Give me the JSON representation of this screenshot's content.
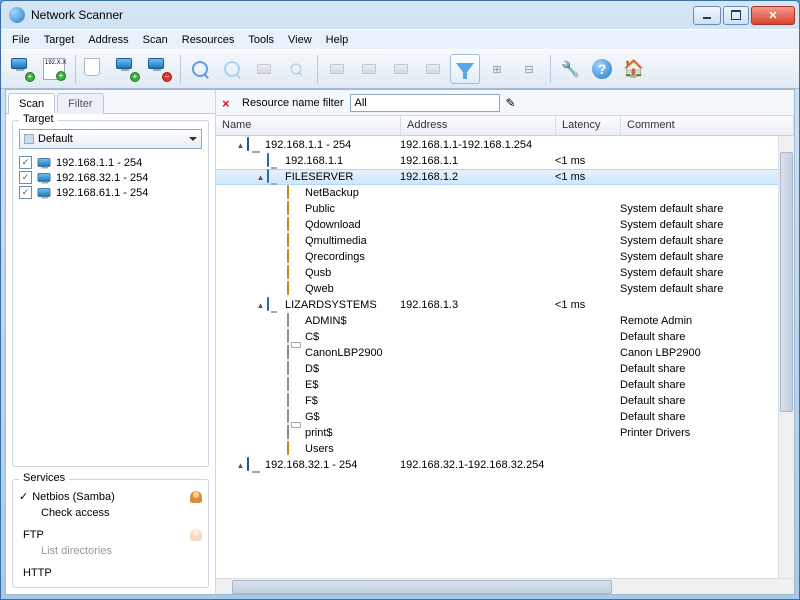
{
  "window": {
    "title": "Network Scanner"
  },
  "menu": [
    "File",
    "Target",
    "Address",
    "Scan",
    "Resources",
    "Tools",
    "View",
    "Help"
  ],
  "sidebar": {
    "tabs": [
      "Scan",
      "Filter"
    ],
    "active_tab": 0,
    "target_group": "Target",
    "default_combo": "Default",
    "ranges": [
      {
        "checked": true,
        "label": "192.168.1.1 - 254"
      },
      {
        "checked": true,
        "label": "192.168.32.1 - 254"
      },
      {
        "checked": true,
        "label": "192.168.61.1 - 254"
      }
    ],
    "services_group": "Services",
    "services": [
      {
        "checked": true,
        "label": "Netbios (Samba)",
        "sub": "Check access",
        "sub_checked": false
      },
      {
        "checked": false,
        "label": "FTP",
        "sub": "List directories",
        "sub_checked": false
      },
      {
        "checked": false,
        "label": "HTTP",
        "sub": null
      }
    ]
  },
  "filter": {
    "close": "×",
    "label": "Resource name filter",
    "value": "All"
  },
  "columns": {
    "name": "Name",
    "address": "Address",
    "latency": "Latency",
    "comment": "Comment"
  },
  "tree": [
    {
      "depth": 0,
      "exp": "▲",
      "icon": "monitors",
      "name": "192.168.1.1 - 254",
      "addr": "192.168.1.1-192.168.1.254",
      "lat": "",
      "com": ""
    },
    {
      "depth": 1,
      "exp": "",
      "icon": "monitor",
      "name": "192.168.1.1",
      "addr": "192.168.1.1",
      "lat": "<1 ms",
      "com": ""
    },
    {
      "depth": 1,
      "exp": "▲",
      "icon": "monitor",
      "name": "FILESERVER",
      "addr": "192.168.1.2",
      "lat": "<1 ms",
      "com": "",
      "sel": true
    },
    {
      "depth": 2,
      "exp": "",
      "icon": "folder",
      "name": "NetBackup",
      "addr": "",
      "lat": "",
      "com": ""
    },
    {
      "depth": 2,
      "exp": "",
      "icon": "folder",
      "name": "Public",
      "addr": "",
      "lat": "",
      "com": "System default share"
    },
    {
      "depth": 2,
      "exp": "",
      "icon": "folder",
      "name": "Qdownload",
      "addr": "",
      "lat": "",
      "com": "System default share"
    },
    {
      "depth": 2,
      "exp": "",
      "icon": "folder",
      "name": "Qmultimedia",
      "addr": "",
      "lat": "",
      "com": "System default share"
    },
    {
      "depth": 2,
      "exp": "",
      "icon": "folder",
      "name": "Qrecordings",
      "addr": "",
      "lat": "",
      "com": "System default share"
    },
    {
      "depth": 2,
      "exp": "",
      "icon": "folder",
      "name": "Qusb",
      "addr": "",
      "lat": "",
      "com": "System default share"
    },
    {
      "depth": 2,
      "exp": "",
      "icon": "folder",
      "name": "Qweb",
      "addr": "",
      "lat": "",
      "com": "System default share"
    },
    {
      "depth": 1,
      "exp": "▲",
      "icon": "monitor",
      "name": "LIZARDSYSTEMS",
      "addr": "192.168.1.3",
      "lat": "<1 ms",
      "com": ""
    },
    {
      "depth": 2,
      "exp": "",
      "icon": "folder-g",
      "name": "ADMIN$",
      "addr": "",
      "lat": "",
      "com": "Remote Admin"
    },
    {
      "depth": 2,
      "exp": "",
      "icon": "folder-g",
      "name": "C$",
      "addr": "",
      "lat": "",
      "com": "Default share"
    },
    {
      "depth": 2,
      "exp": "",
      "icon": "printer",
      "name": "CanonLBP2900",
      "addr": "",
      "lat": "",
      "com": "Canon LBP2900"
    },
    {
      "depth": 2,
      "exp": "",
      "icon": "folder-g",
      "name": "D$",
      "addr": "",
      "lat": "",
      "com": "Default share"
    },
    {
      "depth": 2,
      "exp": "",
      "icon": "folder-g",
      "name": "E$",
      "addr": "",
      "lat": "",
      "com": "Default share"
    },
    {
      "depth": 2,
      "exp": "",
      "icon": "folder-g",
      "name": "F$",
      "addr": "",
      "lat": "",
      "com": "Default share"
    },
    {
      "depth": 2,
      "exp": "",
      "icon": "folder-g",
      "name": "G$",
      "addr": "",
      "lat": "",
      "com": "Default share"
    },
    {
      "depth": 2,
      "exp": "",
      "icon": "printer",
      "name": "print$",
      "addr": "",
      "lat": "",
      "com": "Printer Drivers"
    },
    {
      "depth": 2,
      "exp": "",
      "icon": "folder",
      "name": "Users",
      "addr": "",
      "lat": "",
      "com": ""
    },
    {
      "depth": 0,
      "exp": "▲",
      "icon": "monitors",
      "name": "192.168.32.1 - 254",
      "addr": "192.168.32.1-192.168.32.254",
      "lat": "",
      "com": ""
    }
  ]
}
